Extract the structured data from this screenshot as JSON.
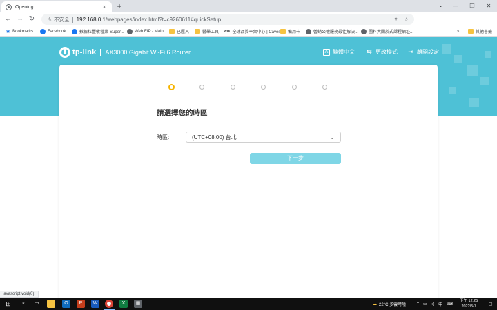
{
  "browser": {
    "tab_title": "Opening...",
    "new_tab": "+",
    "close_tab": "×",
    "security_label": "不安全",
    "url_host": "192.168.0.1",
    "url_path": "/webpages/index.html?t=c9260611#quickSetup",
    "profile_initial": "A",
    "bookmarks": [
      {
        "label": "Bookmarks",
        "kind": "star"
      },
      {
        "label": "Facebook",
        "kind": "site",
        "color": "#1877f2"
      },
      {
        "label": "數據粒豐收種業-Super...",
        "kind": "site",
        "color": "#1877f2"
      },
      {
        "label": "Web EIP - Main",
        "kind": "site",
        "color": "#5f6368"
      },
      {
        "label": "已匯入",
        "kind": "folder"
      },
      {
        "label": "醫學工具",
        "kind": "folder"
      },
      {
        "label": "全球品質平台中心 | Caves...",
        "kind": "wix"
      },
      {
        "label": "備用卡",
        "kind": "folder"
      },
      {
        "label": "營銷公權服務最佳解決...",
        "kind": "site",
        "color": "#5f6368"
      },
      {
        "label": "圖料大關於式課程網址...",
        "kind": "site",
        "color": "#5f6368"
      }
    ],
    "other_bookmarks": "其他書籤",
    "status_text": "javascript:void(0);"
  },
  "router": {
    "brand": "tp-link",
    "model": "AX3000 Gigabit Wi-Fi 6 Router",
    "nav": [
      {
        "label": "繁體中文",
        "icon": "A"
      },
      {
        "label": "更改模式",
        "icon": "⇆"
      },
      {
        "label": "離開設定",
        "icon": "⇥"
      }
    ],
    "steps_total": 6,
    "current_step": 1,
    "heading": "請選擇您的時區",
    "timezone_label": "時區:",
    "timezone_value": "(UTC+08:00) 台北",
    "next_button": "下一步"
  },
  "taskbar": {
    "weather": "22°C 多雲時陰",
    "ime": "中",
    "time": "下午 12:25",
    "date": "2022/5/7"
  }
}
